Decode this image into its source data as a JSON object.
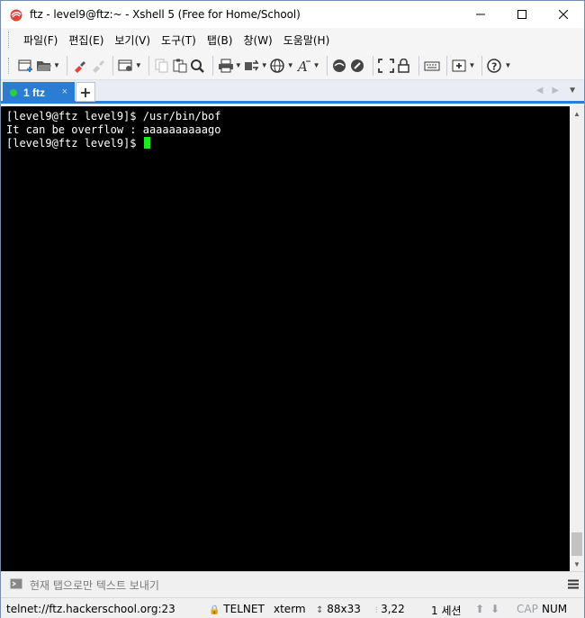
{
  "window": {
    "title": "ftz - level9@ftz:~ - Xshell 5 (Free for Home/School)"
  },
  "menu": [
    {
      "label": "파일(F)"
    },
    {
      "label": "편집(E)"
    },
    {
      "label": "보기(V)"
    },
    {
      "label": "도구(T)"
    },
    {
      "label": "탭(B)"
    },
    {
      "label": "창(W)"
    },
    {
      "label": "도움말(H)"
    }
  ],
  "tabs": [
    {
      "label": "1 ftz",
      "close": "×",
      "status_color": "#2ecc40"
    }
  ],
  "tab_add_label": "+",
  "terminal": {
    "lines": [
      "[level9@ftz level9]$ /usr/bin/bof",
      "It can be overflow : aaaaaaaaaago",
      "[level9@ftz level9]$ "
    ],
    "cursor_color": "#1ee81e"
  },
  "compose": {
    "placeholder": "현재 탭으로만 텍스트 보내기"
  },
  "status": {
    "connection": "telnet://ftz.hackerschool.org:23",
    "protocol": "TELNET",
    "terminal_type": "xterm",
    "size": "88x33",
    "cursor_pos": "3,22",
    "sessions": "1 세션",
    "cap": "CAP",
    "num": "NUM"
  },
  "colors": {
    "accent": "#2b7cd3",
    "terminal_bg": "#000000",
    "terminal_fg": "#ffffff"
  }
}
